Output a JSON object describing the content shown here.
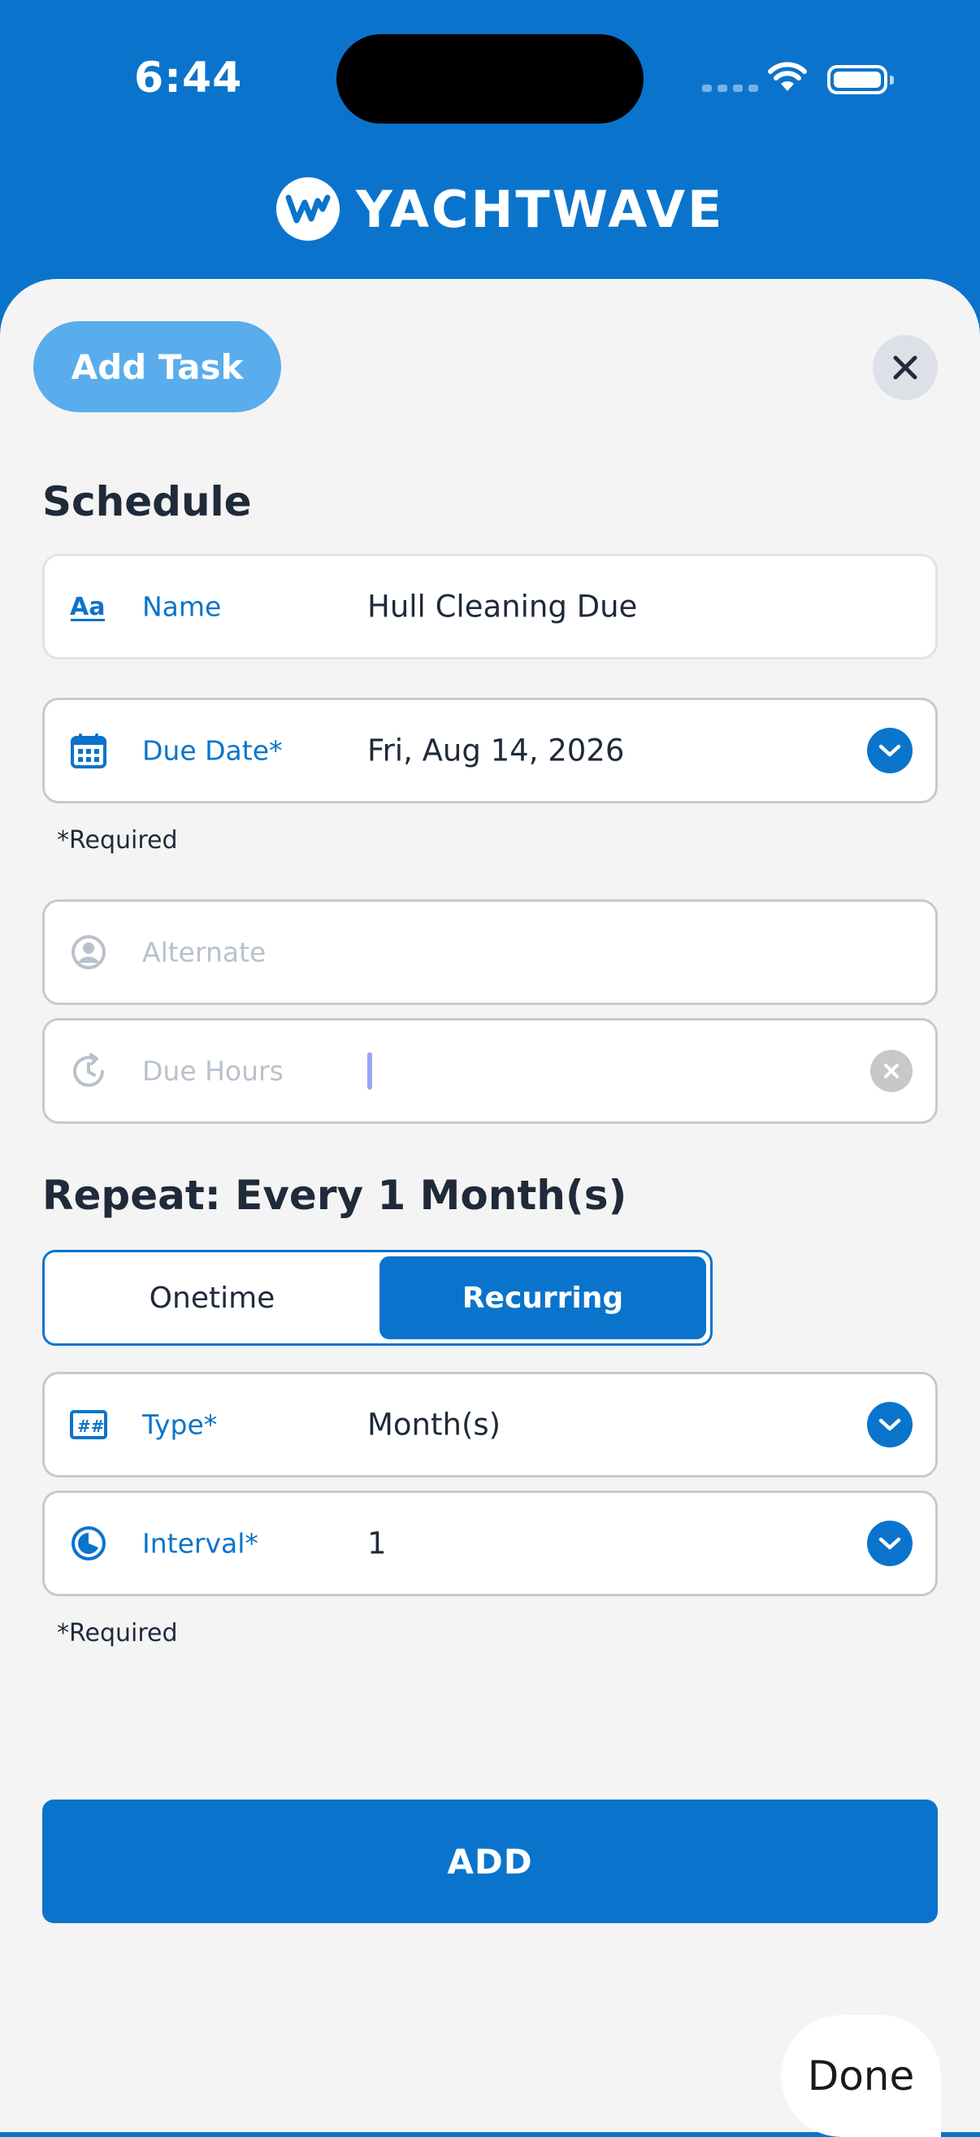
{
  "status_bar": {
    "time": "6:44"
  },
  "header": {
    "brand_name": "YACHTWAVE",
    "brand_color": "#0a74cc"
  },
  "sheet": {
    "title_pill": "Add Task",
    "close_icon": "close-icon",
    "schedule": {
      "title": "Schedule",
      "fields": [
        {
          "icon": "text-format-icon",
          "label": "Name",
          "value": "Hull Cleaning Due"
        },
        {
          "icon": "calendar-icon",
          "label": "Due Date*",
          "value": "Fri, Aug 14, 2026",
          "control": "chevron-down-icon"
        },
        {
          "icon": "user-circle-icon",
          "label": "Alternate",
          "value": ""
        },
        {
          "icon": "clock-reset-icon",
          "label": "Due Hours",
          "value": "",
          "control": "clear-icon"
        }
      ],
      "required_note": "*Required"
    },
    "repeat": {
      "title": "Repeat: Every 1 Month(s)",
      "segments": [
        {
          "label": "Onetime",
          "selected": false
        },
        {
          "label": "Recurring",
          "selected": true
        }
      ],
      "fields": [
        {
          "icon": "hash-grid-icon",
          "label": "Type*",
          "value": "Month(s)",
          "control": "chevron-down-icon"
        },
        {
          "icon": "interval-clock-icon",
          "label": "Interval*",
          "value": "1",
          "control": "chevron-down-icon"
        }
      ],
      "required_note": "*Required"
    },
    "add_button": "ADD"
  },
  "keyboard_toolbar": {
    "done_label": "Done"
  }
}
